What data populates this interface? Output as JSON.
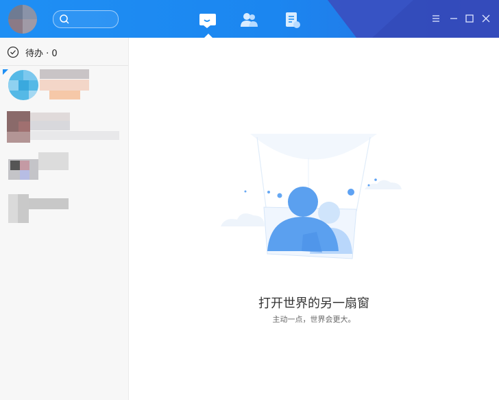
{
  "titlebar": {
    "nav": [
      {
        "name": "messages",
        "icon": "chat-icon",
        "active": true
      },
      {
        "name": "contacts",
        "icon": "contacts-icon",
        "active": false
      },
      {
        "name": "documents",
        "icon": "document-icon",
        "active": false
      }
    ],
    "window_controls": [
      "menu-icon",
      "minimize-icon",
      "maximize-icon",
      "close-icon"
    ],
    "colors": {
      "primary": "#1f8ff4",
      "accent_dark": "#3349b8"
    }
  },
  "sidebar": {
    "todo_label": "待办 · 0"
  },
  "main": {
    "slogan": "打开世界的另一扇窗",
    "subtitle": "主动一点，世界会更大。"
  }
}
